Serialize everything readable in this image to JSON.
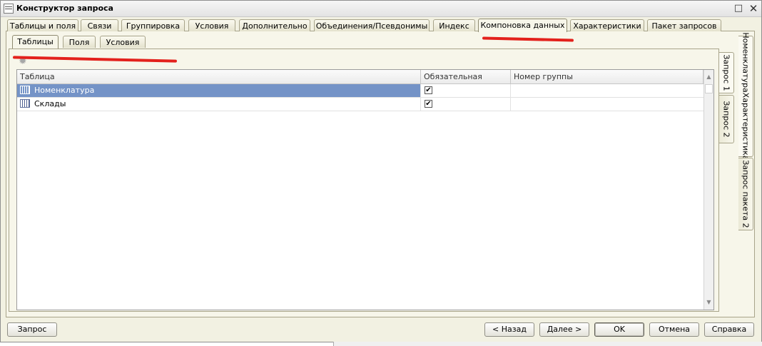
{
  "window": {
    "title": "Конструктор запроса",
    "maximize_icon": "□",
    "close_icon": "✕"
  },
  "main_tabs": [
    {
      "label": "Таблицы и поля"
    },
    {
      "label": "Связи"
    },
    {
      "label": "Группировка"
    },
    {
      "label": "Условия"
    },
    {
      "label": "Дополнительно"
    },
    {
      "label": "Объединения/Псевдонимы"
    },
    {
      "label": "Индекс"
    },
    {
      "label": "Компоновка данных",
      "active": true
    },
    {
      "label": "Характеристики"
    },
    {
      "label": "Пакет запросов"
    }
  ],
  "sub_tabs": [
    {
      "label": "Таблицы",
      "active": true
    },
    {
      "label": "Поля"
    },
    {
      "label": "Условия"
    }
  ],
  "grid": {
    "columns": [
      "Таблица",
      "Обязательная",
      "Номер группы"
    ],
    "rows": [
      {
        "name": "Номенклатура",
        "required": true,
        "group": "",
        "selected": true
      },
      {
        "name": "Склады",
        "required": true,
        "group": "",
        "selected": false
      }
    ],
    "check_mark": "✔",
    "scroll_up": "▲",
    "scroll_down": "▼"
  },
  "query_tabs": [
    {
      "label": "Запрос 1",
      "active": true
    },
    {
      "label": "Запрос 2"
    }
  ],
  "batch_tabs": [
    {
      "label": "НоменклатураХарактеристика",
      "active": true
    },
    {
      "label": "Запрос пакета 2"
    }
  ],
  "buttons": {
    "query": "Запрос",
    "back": "< Назад",
    "next": "Далее >",
    "ok": "OK",
    "cancel": "Отмена",
    "help": "Справка"
  },
  "icons": {
    "settings": "✹"
  },
  "colors": {
    "selection": "#7493c7",
    "annotation": "#e3211c",
    "panel": "#f7f6ea"
  }
}
